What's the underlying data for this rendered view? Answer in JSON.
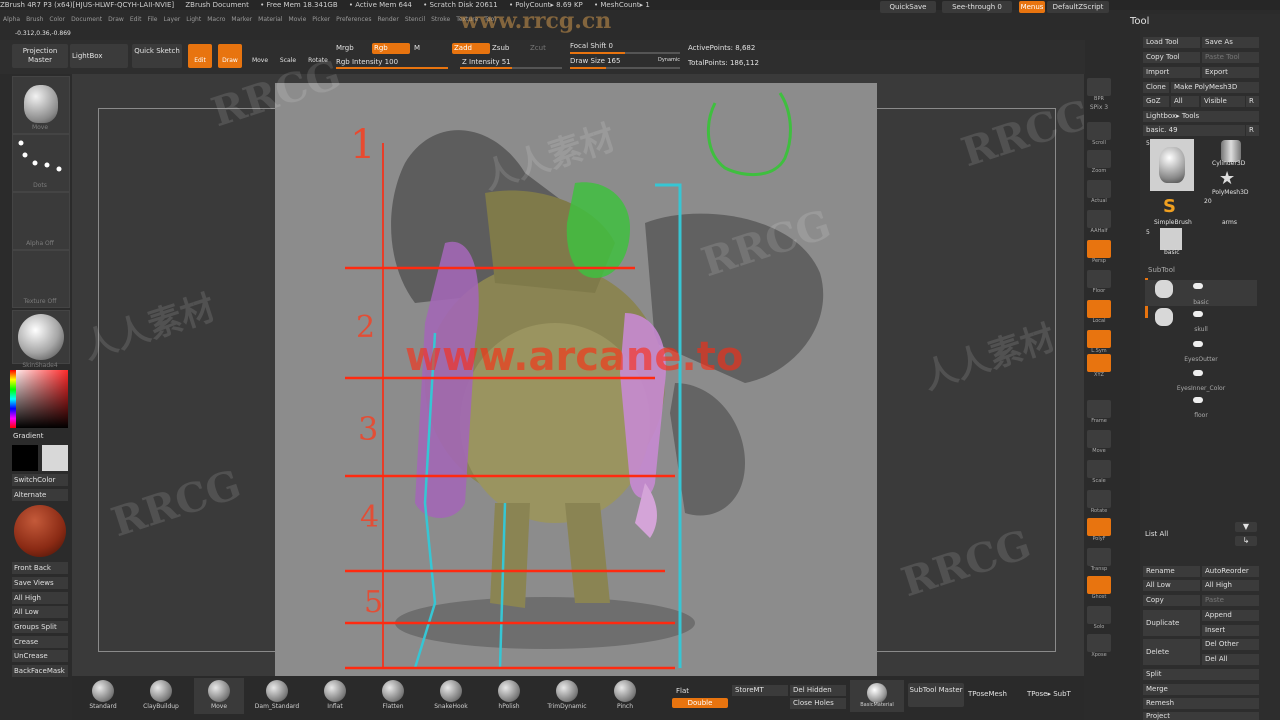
{
  "titlebar": {
    "app": "ZBrush 4R7 P3 (x64)[HJUS-HLWF-QCYH-LAII-NVIE]",
    "doc": "ZBrush Document",
    "free_mem": "• Free Mem 18.341GB",
    "active_mem": "• Active Mem 644",
    "scratch": "• Scratch Disk 20611",
    "poly": "• PolyCount▸ 8.69 KP",
    "mesh": "• MeshCount▸ 1",
    "quicksave": "QuickSave",
    "seethrough": "See-through  0",
    "menus": "Menus",
    "script": "DefaultZScript"
  },
  "menubar": [
    "Alpha",
    "Brush",
    "Color",
    "Document",
    "Draw",
    "Edit",
    "File",
    "Layer",
    "Light",
    "Macro",
    "Marker",
    "Material",
    "Movie",
    "Picker",
    "Preferences",
    "Render",
    "Stencil",
    "Stroke",
    "Texture",
    "Tool"
  ],
  "coords": "-0.312,0.36,-0.869",
  "toolbar": {
    "projection": "Projection Master",
    "lightbox": "LightBox",
    "quicksketch": "Quick Sketch",
    "edit": "Edit",
    "draw": "Draw",
    "move": "Move",
    "scale": "Scale",
    "rotate": "Rotate",
    "mrgb": "Mrgb",
    "rgb": "Rgb",
    "m": "M",
    "zadd": "Zadd",
    "zsub": "Zsub",
    "zcut": "Zcut",
    "rgb_intensity": "Rgb Intensity 100",
    "z_intensity": "Z Intensity 51",
    "focal_shift": "Focal Shift 0",
    "draw_size": "Draw Size 165",
    "dynamic": "Dynamic",
    "active_points": "ActivePoints: 8,682",
    "total_points": "TotalPoints: 186,112",
    "rgb_fill": 1.0,
    "z_fill": 0.51,
    "focal_fill": 0.5,
    "draw_fill": 0.33
  },
  "left": {
    "thumbs": [
      "Move",
      "Dots",
      "Alpha Off",
      "Texture Off",
      "SkinShade4"
    ],
    "gradient": "Gradient",
    "switchcolor": "SwitchColor",
    "alternate": "Alternate",
    "buttons": [
      "Front  Back",
      "Save Views",
      "All High",
      "All Low",
      "Groups Split",
      "Crease",
      "UnCrease",
      "BackFaceMask"
    ]
  },
  "right": {
    "icons": [
      "BPR",
      "Scroll",
      "Zoom",
      "Actual",
      "AAHalf",
      "Persp",
      "Floor",
      "Local",
      "L.Sym",
      "XYZ",
      "Frame",
      "Move",
      "Scale",
      "Rotate",
      "PolyF",
      "Transp",
      "Ghost",
      "Solo",
      "Xpose"
    ],
    "spix": "SPix 3"
  },
  "tool": {
    "title": "Tool",
    "load": "Load Tool",
    "saveas": "Save As",
    "copy": "Copy Tool",
    "paste": "Paste Tool",
    "import": "Import",
    "export": "Export",
    "clone": "Clone",
    "make": "Make PolyMesh3D",
    "goz": "GoZ",
    "all": "All",
    "visible": "Visible",
    "r": "R",
    "lightbox_tools": "Lightbox▸ Tools",
    "basic": "basic. 49",
    "cyl": "Cylinder3D",
    "poly": "PolyMesh3D",
    "simplebrush": "SimpleBrush",
    "arms": "arms",
    "basic_small": "basic",
    "num5": "5",
    "num20": "20",
    "subtool": "SubTool",
    "subtools": [
      "basic",
      "skull",
      "EyesOutter",
      "EyesInner_Color",
      "floor"
    ],
    "listall": "List All",
    "rename": "Rename",
    "autoreorder": "AutoReorder",
    "alllow": "All Low",
    "allhigh": "All High",
    "copy2": "Copy",
    "paste2": "Paste",
    "duplicate": "Duplicate",
    "append": "Append",
    "insert": "Insert",
    "delete": "Delete",
    "delother": "Del Other",
    "delall": "Del All",
    "split": "Split",
    "merge": "Merge",
    "remesh": "Remesh",
    "project": "Project"
  },
  "bottom": {
    "brushes": [
      "Standard",
      "ClayBuildup",
      "Move",
      "Dam_Standard",
      "Inflat",
      "Flatten",
      "SnakeHook",
      "hPolish",
      "TrimDynamic",
      "Pinch"
    ],
    "flat": "Flat",
    "double": "Double",
    "storemt": "StoreMT",
    "delhidden": "Del Hidden",
    "closeholes": "Close Holes",
    "material": "BasicMaterial",
    "subtoolmaster": "SubTool Master",
    "tposemesh": "TPoseMesh",
    "tpose": "TPose▸ SubT"
  },
  "canvas": {
    "url": "www.arcane.to",
    "numbers": [
      "1",
      "2",
      "3",
      "4",
      "5"
    ]
  },
  "watermark": {
    "site": "www.rrcg.cn",
    "text": "RRCG",
    "cn": "人人素材"
  },
  "colors": {
    "accent": "#e8740f",
    "panel": "#2d2d2d"
  }
}
